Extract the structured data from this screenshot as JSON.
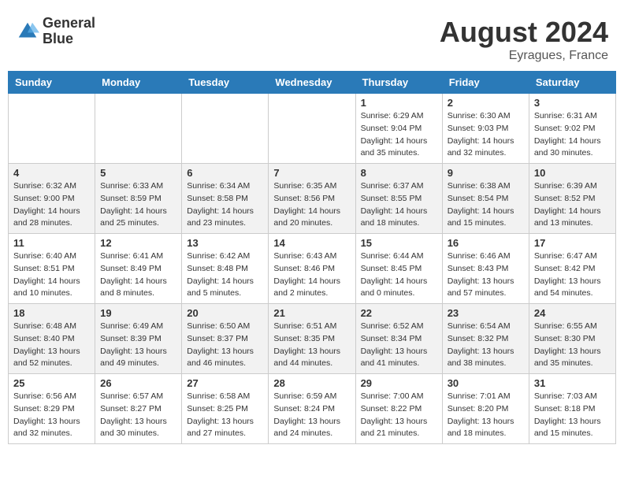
{
  "header": {
    "logo_line1": "General",
    "logo_line2": "Blue",
    "month_year": "August 2024",
    "location": "Eyragues, France"
  },
  "days_of_week": [
    "Sunday",
    "Monday",
    "Tuesday",
    "Wednesday",
    "Thursday",
    "Friday",
    "Saturday"
  ],
  "weeks": [
    [
      {
        "day": "",
        "info": ""
      },
      {
        "day": "",
        "info": ""
      },
      {
        "day": "",
        "info": ""
      },
      {
        "day": "",
        "info": ""
      },
      {
        "day": "1",
        "info": "Sunrise: 6:29 AM\nSunset: 9:04 PM\nDaylight: 14 hours\nand 35 minutes."
      },
      {
        "day": "2",
        "info": "Sunrise: 6:30 AM\nSunset: 9:03 PM\nDaylight: 14 hours\nand 32 minutes."
      },
      {
        "day": "3",
        "info": "Sunrise: 6:31 AM\nSunset: 9:02 PM\nDaylight: 14 hours\nand 30 minutes."
      }
    ],
    [
      {
        "day": "4",
        "info": "Sunrise: 6:32 AM\nSunset: 9:00 PM\nDaylight: 14 hours\nand 28 minutes."
      },
      {
        "day": "5",
        "info": "Sunrise: 6:33 AM\nSunset: 8:59 PM\nDaylight: 14 hours\nand 25 minutes."
      },
      {
        "day": "6",
        "info": "Sunrise: 6:34 AM\nSunset: 8:58 PM\nDaylight: 14 hours\nand 23 minutes."
      },
      {
        "day": "7",
        "info": "Sunrise: 6:35 AM\nSunset: 8:56 PM\nDaylight: 14 hours\nand 20 minutes."
      },
      {
        "day": "8",
        "info": "Sunrise: 6:37 AM\nSunset: 8:55 PM\nDaylight: 14 hours\nand 18 minutes."
      },
      {
        "day": "9",
        "info": "Sunrise: 6:38 AM\nSunset: 8:54 PM\nDaylight: 14 hours\nand 15 minutes."
      },
      {
        "day": "10",
        "info": "Sunrise: 6:39 AM\nSunset: 8:52 PM\nDaylight: 14 hours\nand 13 minutes."
      }
    ],
    [
      {
        "day": "11",
        "info": "Sunrise: 6:40 AM\nSunset: 8:51 PM\nDaylight: 14 hours\nand 10 minutes."
      },
      {
        "day": "12",
        "info": "Sunrise: 6:41 AM\nSunset: 8:49 PM\nDaylight: 14 hours\nand 8 minutes."
      },
      {
        "day": "13",
        "info": "Sunrise: 6:42 AM\nSunset: 8:48 PM\nDaylight: 14 hours\nand 5 minutes."
      },
      {
        "day": "14",
        "info": "Sunrise: 6:43 AM\nSunset: 8:46 PM\nDaylight: 14 hours\nand 2 minutes."
      },
      {
        "day": "15",
        "info": "Sunrise: 6:44 AM\nSunset: 8:45 PM\nDaylight: 14 hours\nand 0 minutes."
      },
      {
        "day": "16",
        "info": "Sunrise: 6:46 AM\nSunset: 8:43 PM\nDaylight: 13 hours\nand 57 minutes."
      },
      {
        "day": "17",
        "info": "Sunrise: 6:47 AM\nSunset: 8:42 PM\nDaylight: 13 hours\nand 54 minutes."
      }
    ],
    [
      {
        "day": "18",
        "info": "Sunrise: 6:48 AM\nSunset: 8:40 PM\nDaylight: 13 hours\nand 52 minutes."
      },
      {
        "day": "19",
        "info": "Sunrise: 6:49 AM\nSunset: 8:39 PM\nDaylight: 13 hours\nand 49 minutes."
      },
      {
        "day": "20",
        "info": "Sunrise: 6:50 AM\nSunset: 8:37 PM\nDaylight: 13 hours\nand 46 minutes."
      },
      {
        "day": "21",
        "info": "Sunrise: 6:51 AM\nSunset: 8:35 PM\nDaylight: 13 hours\nand 44 minutes."
      },
      {
        "day": "22",
        "info": "Sunrise: 6:52 AM\nSunset: 8:34 PM\nDaylight: 13 hours\nand 41 minutes."
      },
      {
        "day": "23",
        "info": "Sunrise: 6:54 AM\nSunset: 8:32 PM\nDaylight: 13 hours\nand 38 minutes."
      },
      {
        "day": "24",
        "info": "Sunrise: 6:55 AM\nSunset: 8:30 PM\nDaylight: 13 hours\nand 35 minutes."
      }
    ],
    [
      {
        "day": "25",
        "info": "Sunrise: 6:56 AM\nSunset: 8:29 PM\nDaylight: 13 hours\nand 32 minutes."
      },
      {
        "day": "26",
        "info": "Sunrise: 6:57 AM\nSunset: 8:27 PM\nDaylight: 13 hours\nand 30 minutes."
      },
      {
        "day": "27",
        "info": "Sunrise: 6:58 AM\nSunset: 8:25 PM\nDaylight: 13 hours\nand 27 minutes."
      },
      {
        "day": "28",
        "info": "Sunrise: 6:59 AM\nSunset: 8:24 PM\nDaylight: 13 hours\nand 24 minutes."
      },
      {
        "day": "29",
        "info": "Sunrise: 7:00 AM\nSunset: 8:22 PM\nDaylight: 13 hours\nand 21 minutes."
      },
      {
        "day": "30",
        "info": "Sunrise: 7:01 AM\nSunset: 8:20 PM\nDaylight: 13 hours\nand 18 minutes."
      },
      {
        "day": "31",
        "info": "Sunrise: 7:03 AM\nSunset: 8:18 PM\nDaylight: 13 hours\nand 15 minutes."
      }
    ]
  ]
}
